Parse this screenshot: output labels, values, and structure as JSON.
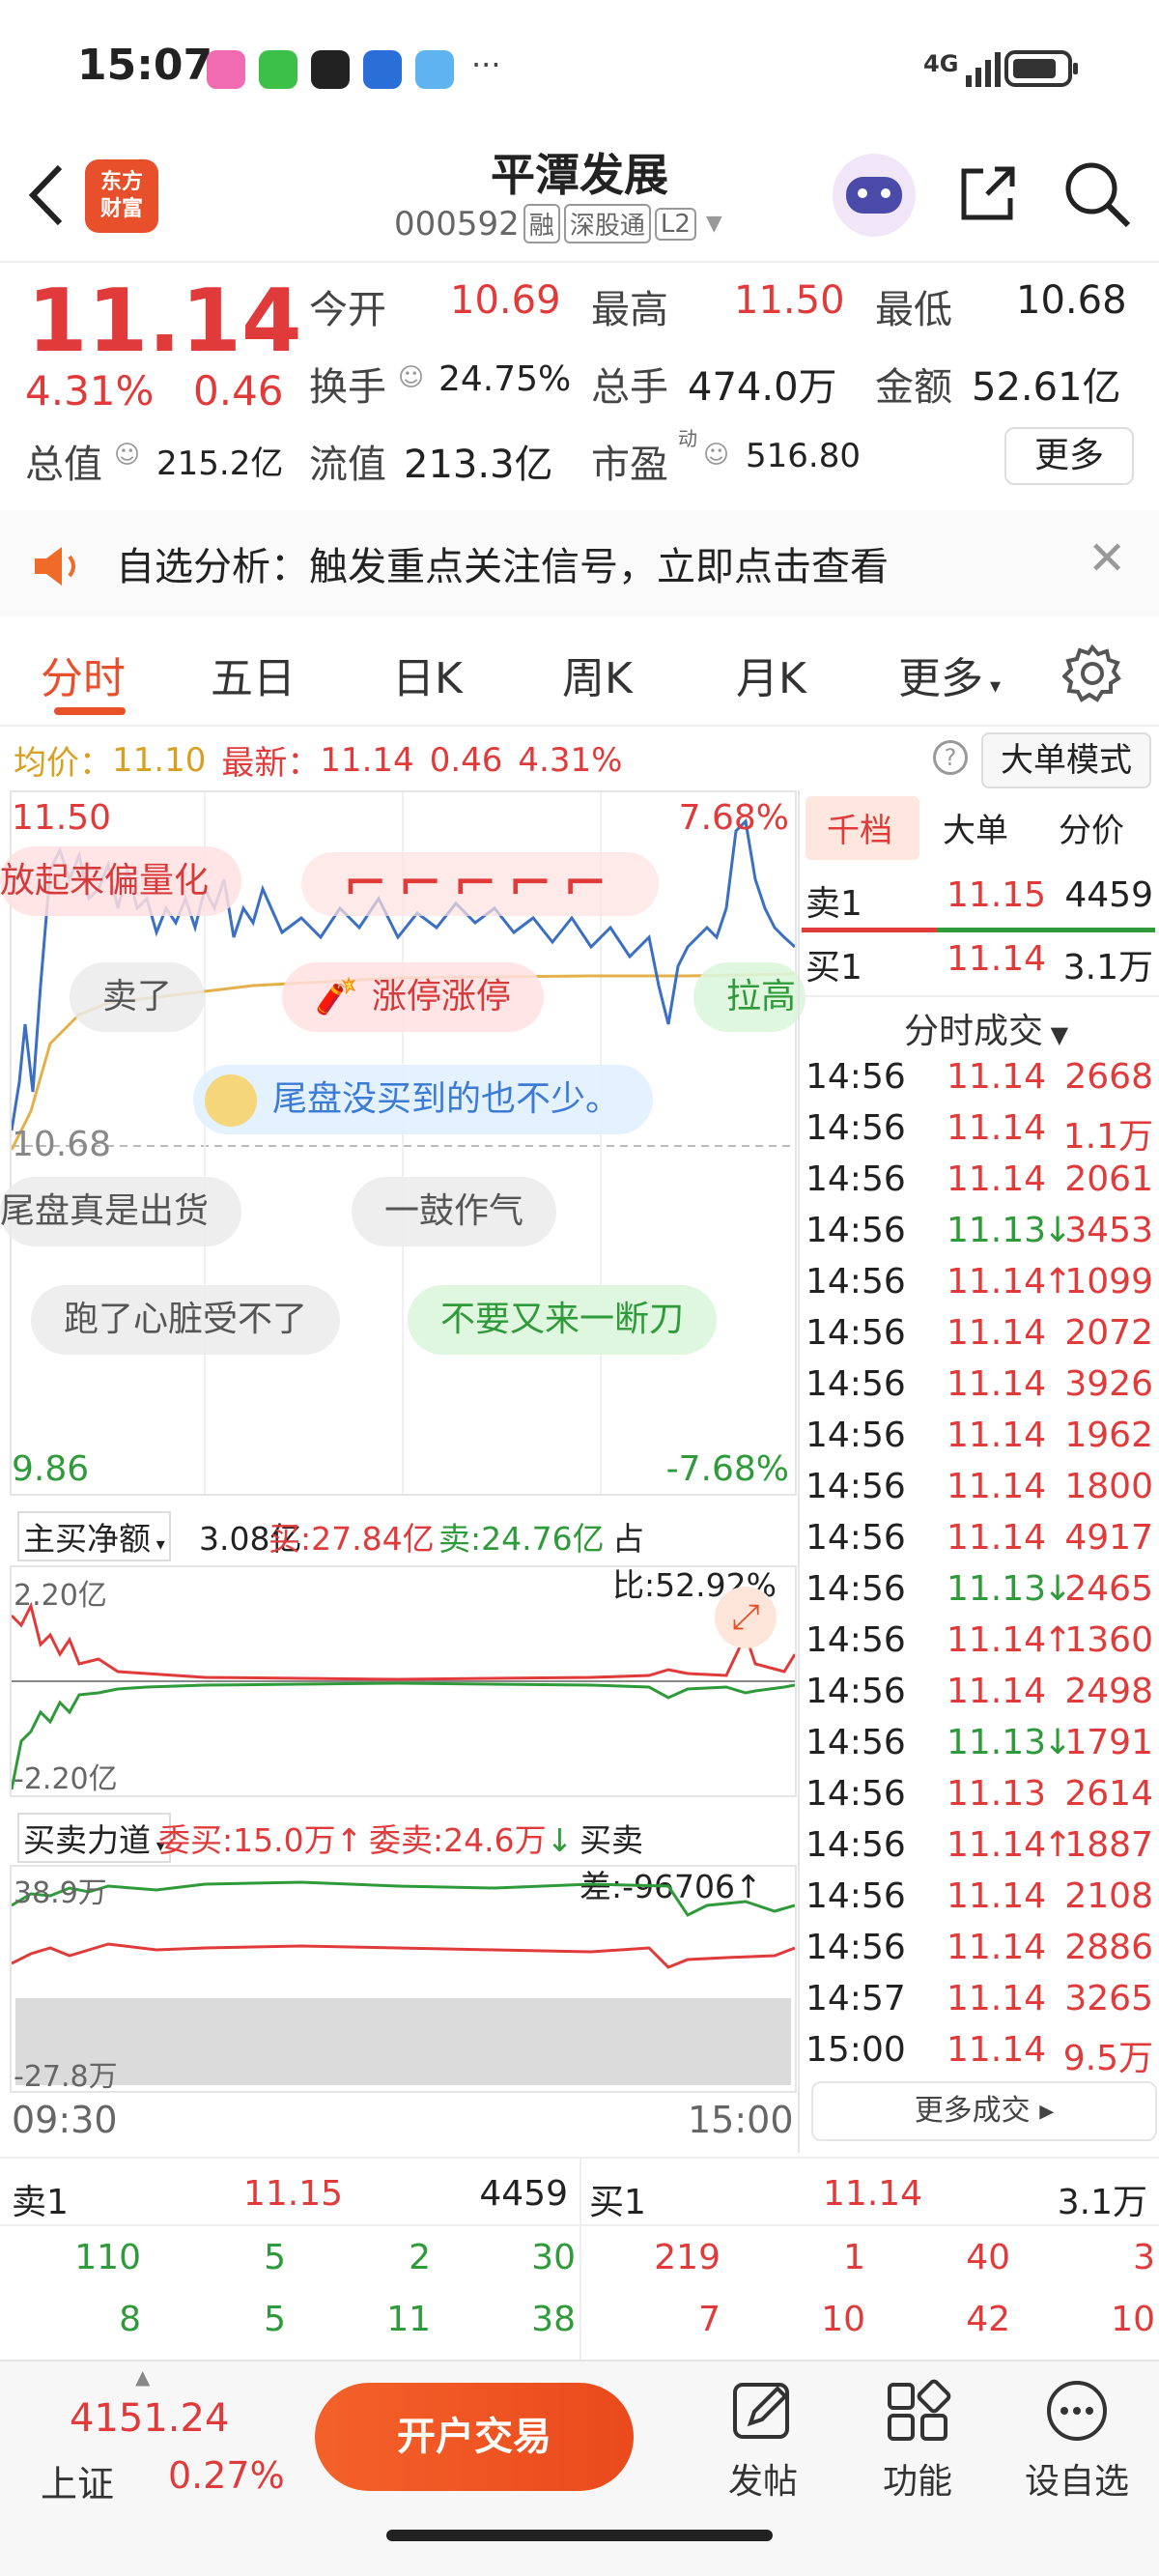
{
  "status_bar": {
    "time": "15:07",
    "network": "4G",
    "more": "···"
  },
  "header": {
    "logo_line1": "东方",
    "logo_line2": "财富",
    "title": "平潭发展",
    "code": "000592",
    "tags": [
      "融",
      "深股通",
      "L2"
    ]
  },
  "quote": {
    "price": "11.14",
    "change_pct": "4.31%",
    "change": "0.46",
    "fields": [
      {
        "label": "今开",
        "value": "10.69",
        "color": "red"
      },
      {
        "label": "最高",
        "value": "11.50",
        "color": "red"
      },
      {
        "label": "最低",
        "value": "10.68",
        "color": "dark"
      },
      {
        "label": "换手",
        "value": "24.75%",
        "color": "dark"
      },
      {
        "label": "总手",
        "value": "474.0万",
        "color": "dark"
      },
      {
        "label": "金额",
        "value": "52.61亿",
        "color": "dark"
      },
      {
        "label": "总值",
        "value": "215.2亿",
        "color": "dark"
      },
      {
        "label": "流值",
        "value": "213.3亿",
        "color": "dark"
      },
      {
        "label": "市盈",
        "value": "516.80",
        "color": "dark"
      }
    ],
    "pe_superscript": "动",
    "more_label": "更多"
  },
  "notice": {
    "text": "自选分析：触发重点关注信号，立即点击查看"
  },
  "tabs": [
    "分时",
    "五日",
    "日K",
    "周K",
    "月K",
    "更多"
  ],
  "price_line": {
    "avg_label": "均价：",
    "avg_value": "11.10",
    "latest_label": "最新：",
    "latest_value": "11.14",
    "change": "0.46",
    "change_pct": "4.31%",
    "big_order_mode": "大单模式"
  },
  "chart": {
    "y_top": "11.50",
    "y_top_pct": "7.68%",
    "y_mid": "10.68",
    "y_bottom": "9.86",
    "y_bottom_pct": "-7.68%",
    "time_start": "09:30",
    "time_end": "15:00",
    "bubbles": [
      "放起来偏量化",
      "卖了",
      "涨停涨停",
      "拉高",
      "尾盘没买到的也不少。",
      "尾盘真是出货",
      "一鼓作气",
      "跑了心脏受不了",
      "不要又来一断刀"
    ],
    "net_flow": {
      "label": "主买净额",
      "value": "3.08亿",
      "buy": "买:27.84亿",
      "sell": "卖:24.76亿",
      "ratio": "占比:52.92%",
      "y_top": "2.20亿",
      "y_bottom": "-2.20亿"
    },
    "force": {
      "label": "买卖力道",
      "bid": "委买:15.0万",
      "ask": "委卖:24.6万",
      "diff": "买卖差:-96706",
      "y_top": "38.9万",
      "y_bottom": "-27.8万"
    }
  },
  "right_panel": {
    "tabs": [
      "千档",
      "大单",
      "分价"
    ],
    "sell1": {
      "label": "卖1",
      "price": "11.15",
      "vol": "4459"
    },
    "buy1": {
      "label": "买1",
      "price": "11.14",
      "vol": "3.1万"
    },
    "ticks_title": "分时成交",
    "ticks": [
      {
        "time": "14:56",
        "price": "11.14",
        "vol": "2668",
        "dir": ""
      },
      {
        "time": "14:56",
        "price": "11.14",
        "vol": "1.1万",
        "dir": ""
      },
      {
        "time": "14:56",
        "price": "11.14",
        "vol": "2061",
        "dir": ""
      },
      {
        "time": "14:56",
        "price": "11.13",
        "vol": "3453",
        "dir": "down"
      },
      {
        "time": "14:56",
        "price": "11.14",
        "vol": "1099",
        "dir": "up"
      },
      {
        "time": "14:56",
        "price": "11.14",
        "vol": "2072",
        "dir": ""
      },
      {
        "time": "14:56",
        "price": "11.14",
        "vol": "3926",
        "dir": ""
      },
      {
        "time": "14:56",
        "price": "11.14",
        "vol": "1962",
        "dir": ""
      },
      {
        "time": "14:56",
        "price": "11.14",
        "vol": "1800",
        "dir": ""
      },
      {
        "time": "14:56",
        "price": "11.14",
        "vol": "4917",
        "dir": ""
      },
      {
        "time": "14:56",
        "price": "11.13",
        "vol": "2465",
        "dir": "down"
      },
      {
        "time": "14:56",
        "price": "11.14",
        "vol": "1360",
        "dir": "up"
      },
      {
        "time": "14:56",
        "price": "11.14",
        "vol": "2498",
        "dir": ""
      },
      {
        "time": "14:56",
        "price": "11.13",
        "vol": "1791",
        "dir": "down"
      },
      {
        "time": "14:56",
        "price": "11.13",
        "vol": "2614",
        "dir": ""
      },
      {
        "time": "14:56",
        "price": "11.14",
        "vol": "1887",
        "dir": "up"
      },
      {
        "time": "14:56",
        "price": "11.14",
        "vol": "2108",
        "dir": ""
      },
      {
        "time": "14:56",
        "price": "11.14",
        "vol": "2886",
        "dir": ""
      },
      {
        "time": "14:57",
        "price": "11.14",
        "vol": "3265",
        "dir": ""
      },
      {
        "time": "15:00",
        "price": "11.14",
        "vol": "9.5万",
        "dir": ""
      }
    ],
    "more_ticks": "更多成交"
  },
  "book": {
    "sell_label": "卖1",
    "sell_price": "11.15",
    "sell_vol": "4459",
    "buy_label": "买1",
    "buy_price": "11.14",
    "buy_vol": "3.1万",
    "sell_rows": [
      [
        "110",
        "5",
        "2",
        "30"
      ],
      [
        "8",
        "5",
        "11",
        "38"
      ]
    ],
    "buy_rows": [
      [
        "219",
        "1",
        "40",
        "3"
      ],
      [
        "7",
        "10",
        "42",
        "10"
      ]
    ]
  },
  "bottom": {
    "index_value": "4151.24",
    "index_name": "上证",
    "index_pct": "0.27%",
    "trade_button": "开户交易",
    "nav": [
      "发帖",
      "功能",
      "设自选"
    ]
  }
}
